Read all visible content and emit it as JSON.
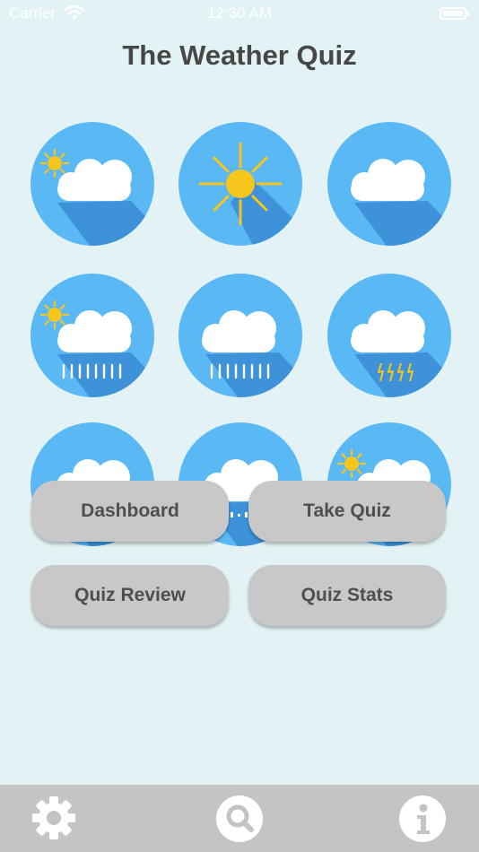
{
  "status_bar": {
    "carrier": "Carrier",
    "time": "12:30 AM"
  },
  "header": {
    "title": "The Weather Quiz"
  },
  "weather_icons": [
    {
      "name": "partly-cloudy-icon"
    },
    {
      "name": "sun-icon"
    },
    {
      "name": "cloud-icon"
    },
    {
      "name": "sun-rain-icon"
    },
    {
      "name": "rain-icon"
    },
    {
      "name": "thunderstorm-icon"
    },
    {
      "name": "snow-icon"
    },
    {
      "name": "sleet-icon"
    },
    {
      "name": "sun-snow-icon"
    }
  ],
  "menu": {
    "dashboard_label": "Dashboard",
    "take_quiz_label": "Take Quiz",
    "quiz_review_label": "Quiz Review",
    "quiz_stats_label": "Quiz Stats"
  },
  "tab_bar": {
    "items": [
      {
        "name": "settings",
        "icon": "gear-icon"
      },
      {
        "name": "search",
        "icon": "search-icon"
      },
      {
        "name": "info",
        "icon": "info-icon"
      }
    ]
  },
  "colors": {
    "background": "#e3f2f4",
    "circle": "#5ab8f5",
    "shadow": "#3d92d9",
    "sun": "#f6c61d",
    "button": "#c8c8c8",
    "tab_bar": "#c4c4c4"
  }
}
